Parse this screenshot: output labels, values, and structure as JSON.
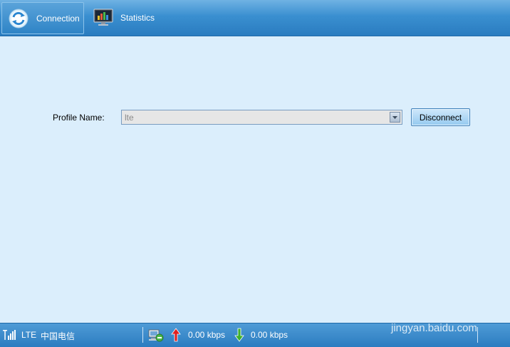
{
  "toolbar": {
    "tabs": [
      {
        "label": "Connection",
        "icon": "connection-refresh-icon",
        "active": true
      },
      {
        "label": "Statistics",
        "icon": "monitor-chart-icon",
        "active": false
      }
    ]
  },
  "main": {
    "profile_label": "Profile Name:",
    "profile_value": "lte",
    "disconnect_label": "Disconnect"
  },
  "statusbar": {
    "network_type": "LTE",
    "carrier": "中国电信",
    "upload_rate": "0.00 kbps",
    "download_rate": "0.00 kbps",
    "icons": [
      "signal-strength-icon",
      "connected-computer-icon",
      "upload-arrow-icon",
      "download-arrow-icon"
    ]
  },
  "watermark": {
    "url": "jingyan.baidu.com"
  },
  "colors": {
    "toolbar": "#2f84c6",
    "background": "#dbeefc",
    "upload_arrow": "#e02020",
    "download_arrow": "#3fb02c"
  }
}
